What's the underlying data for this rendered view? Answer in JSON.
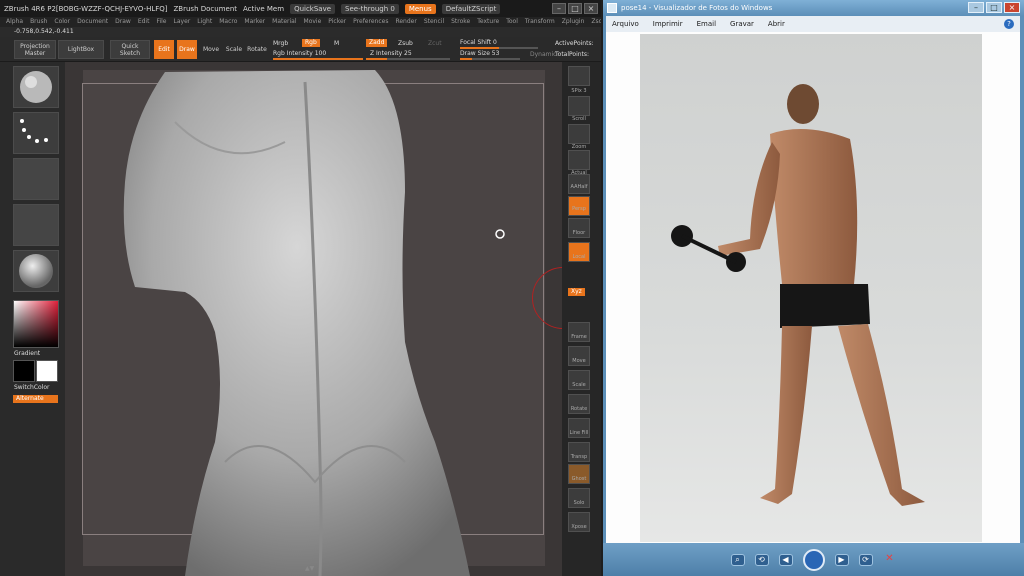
{
  "zbrush": {
    "title": "ZBrush 4R6 P2[BOBG-WZZF-QCHJ-EYVO-HLFQ]",
    "document_label": "ZBrush Document",
    "active_mem": "Active Mem",
    "quicksave": "QuickSave",
    "see_through": "See-through 0",
    "menus_label": "Menus",
    "script_label": "DefaultZScript",
    "menu_items": [
      "Alpha",
      "Brush",
      "Color",
      "Document",
      "Draw",
      "Edit",
      "File",
      "Layer",
      "Light",
      "Macro",
      "Marker",
      "Material",
      "Movie",
      "Picker",
      "Preferences",
      "Render",
      "Stencil",
      "Stroke",
      "Texture",
      "Tool",
      "Transform",
      "Zplugin",
      "Zscript"
    ],
    "coords": "-0.758,0.542,-0.411",
    "toolbar": {
      "projection_master": "Projection Master",
      "lightbox": "LightBox",
      "quick_sketch": "Quick Sketch",
      "edit": "Edit",
      "draw": "Draw",
      "move": "Move",
      "scale": "Scale",
      "rotate": "Rotate",
      "mrgb": "Mrgb",
      "rgb": "Rgb",
      "m": "M",
      "rgb_intensity": "Rgb Intensity 100",
      "zadd": "Zadd",
      "zsub": "Zsub",
      "zcut": "Zcut",
      "z_intensity": "Z Intensity 25",
      "focal_shift": "Focal Shift 0",
      "draw_size": "Draw Size 53",
      "dynamic": "Dynamic",
      "active_points": "ActivePoints:",
      "total_points": "TotalPoints:"
    },
    "left_shelf": {
      "gradient": "Gradient",
      "switch_color": "SwitchColor",
      "alternate": "Alternate"
    },
    "right_shelf": [
      "SPix 3",
      "Scroll",
      "Zoom",
      "Actual",
      "AAHalf",
      "Persp",
      "Floor",
      "Local",
      "Xyz",
      "Frame",
      "Move",
      "Scale",
      "Rotate",
      "Line Fill",
      "Transp",
      "Ghost",
      "Solo",
      "Xpose"
    ],
    "bottom_arrow": "▲▼"
  },
  "viewer": {
    "title": "pose14 - Visualizador de Fotos do Windows",
    "menu": [
      "Arquivo",
      "Imprimir",
      "Email",
      "Gravar",
      "Abrir"
    ],
    "help": "?",
    "nav_glyphs": [
      "⌕",
      "⟲",
      "◀",
      "▶",
      "⟳",
      "✕"
    ]
  },
  "colors": {
    "zbrush_accent": "#e8741c",
    "viewer_frame": "#5c8fb8"
  }
}
